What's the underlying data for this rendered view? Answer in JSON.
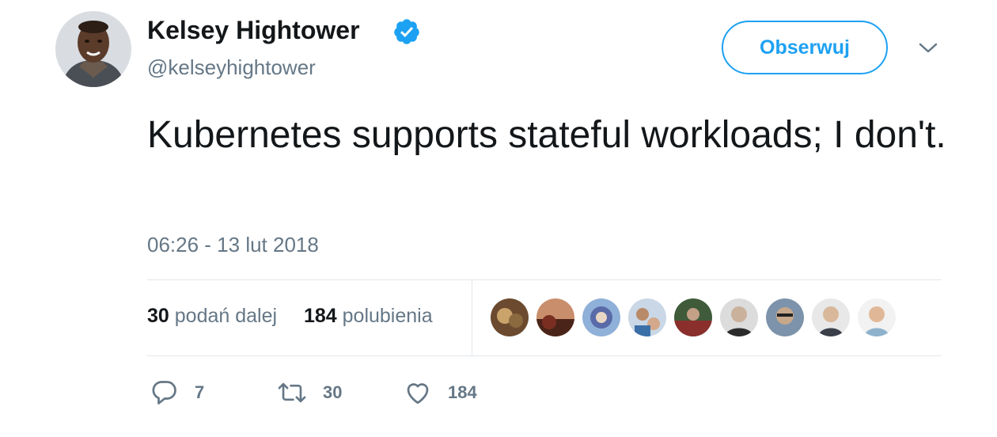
{
  "user": {
    "display_name": "Kelsey Hightower",
    "handle": "@kelseyhightower",
    "verified_icon": "verified-badge-icon"
  },
  "follow_button": {
    "label": "Obserwuj"
  },
  "menu": {
    "icon": "chevron-down-icon"
  },
  "tweet": {
    "text": "Kubernetes supports stateful workloads; I don't.",
    "timestamp": "06:26 - 13 lut 2018"
  },
  "stats": {
    "retweets_count": "30",
    "retweets_label": "podań dalej",
    "likes_count": "184",
    "likes_label": "polubienia"
  },
  "likers_count_shown": 9,
  "actions": {
    "reply_count": "7",
    "retweet_count": "30",
    "like_count": "184"
  },
  "colors": {
    "accent": "#1da1f2",
    "text": "#14171a",
    "muted": "#657786",
    "divider": "#e1e8ed"
  }
}
